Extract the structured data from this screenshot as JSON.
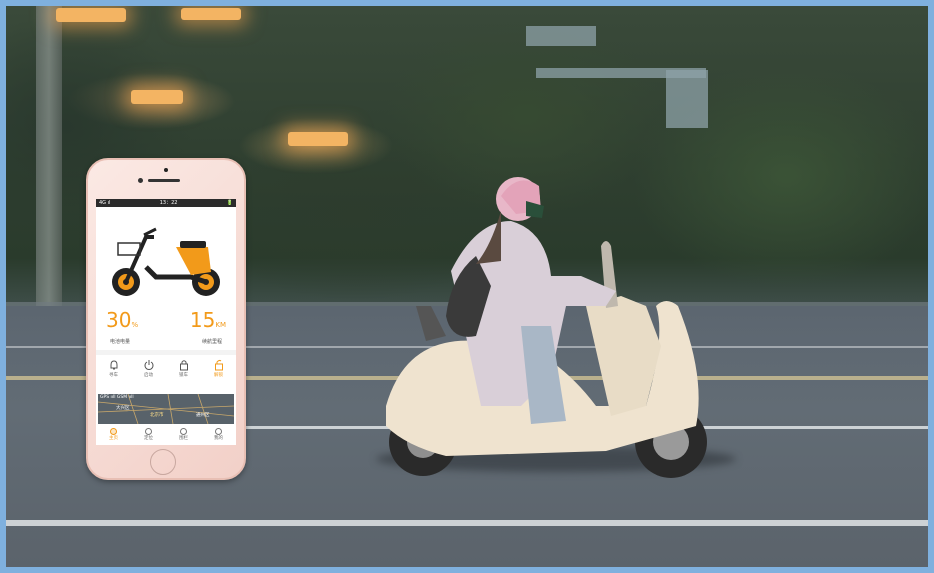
{
  "colors": {
    "accent": "#f29a1a",
    "frame_border": "#7fb0de",
    "phone_body": "#f6ddd6"
  },
  "phone": {
    "statusbar": {
      "left": "4G ıl",
      "time": "13：22",
      "right": "🔋"
    },
    "battery": {
      "value": "30",
      "unit": "%",
      "label": "电池电量"
    },
    "range": {
      "value": "15",
      "unit": "KM",
      "label": "续航里程"
    },
    "controls": [
      {
        "icon": "bell-icon",
        "label": "寻车"
      },
      {
        "icon": "power-icon",
        "label": "启动"
      },
      {
        "icon": "lock-icon",
        "label": "锁车"
      },
      {
        "icon": "unlock-icon",
        "label": "解锁",
        "active": true
      }
    ],
    "map": {
      "signal": "GPS ııll GSM ııll",
      "places": [
        "大兴区",
        "北京市",
        "通州区"
      ]
    },
    "tabs": [
      {
        "icon": "home-icon",
        "label": "主页",
        "active": true
      },
      {
        "icon": "location-icon",
        "label": "定位"
      },
      {
        "icon": "fence-icon",
        "label": "围栏"
      },
      {
        "icon": "profile-icon",
        "label": "我的"
      }
    ]
  }
}
